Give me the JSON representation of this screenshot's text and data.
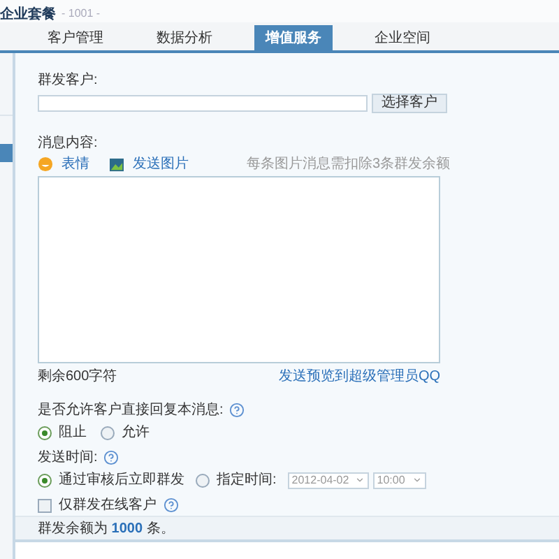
{
  "header": {
    "title": "企业套餐",
    "account": "- 1001 -"
  },
  "nav": {
    "tabs": [
      {
        "label": "客户管理",
        "selected": false
      },
      {
        "label": "数据分析",
        "selected": false
      },
      {
        "label": "增值服务",
        "selected": true
      },
      {
        "label": "企业空间",
        "selected": false
      }
    ]
  },
  "sidebar": {
    "items": [
      {
        "selected": false
      },
      {
        "selected": true
      }
    ]
  },
  "recipients": {
    "label": "群发客户:",
    "button": "选择客户"
  },
  "message": {
    "label": "消息内容:",
    "tools": [
      {
        "kind": "emoji",
        "label": "表情"
      },
      {
        "kind": "image",
        "label": "发送图片"
      }
    ],
    "note": "每条图片消息需扣除3条群发余额",
    "remaining": "剩余600字符",
    "preview_link": "发送预览到超级管理员QQ"
  },
  "reply": {
    "label": "是否允许客户直接回复本消息:",
    "options": [
      {
        "label": "阻止",
        "selected": true
      },
      {
        "label": "允许",
        "selected": false
      }
    ]
  },
  "send_time": {
    "label": "发送时间:",
    "options": [
      {
        "label": "通过审核后立即群发",
        "selected": true
      },
      {
        "label": "指定时间:",
        "selected": false
      }
    ],
    "date": "2012-04-02",
    "time": "10:00"
  },
  "online_only": {
    "label": "仅群发在线客户",
    "checked": false
  },
  "footer": {
    "text": "群发余额为 **1000** 条。"
  }
}
